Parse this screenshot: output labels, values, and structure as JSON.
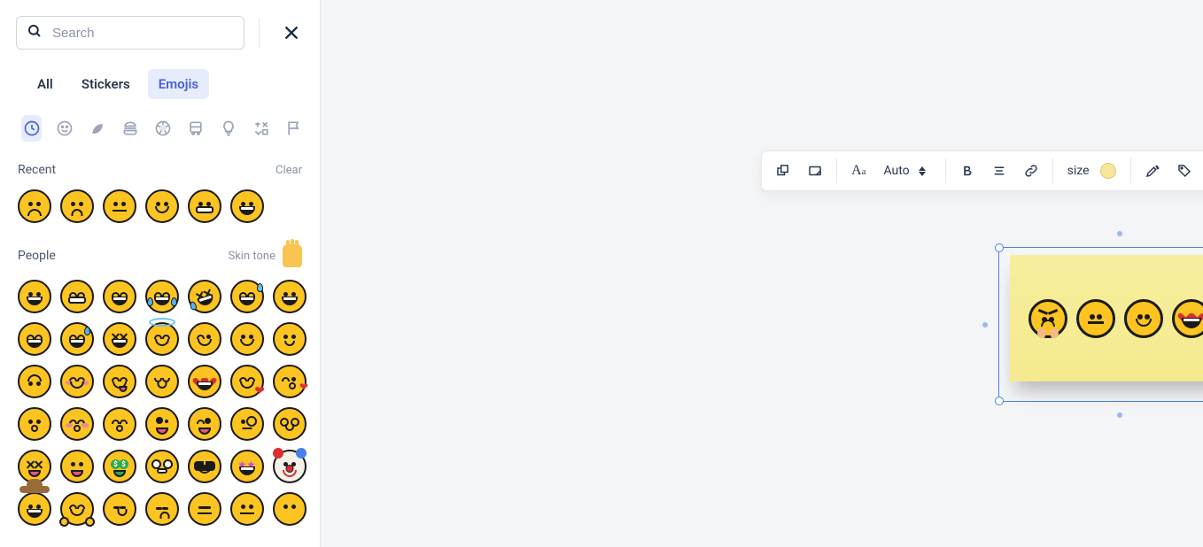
{
  "sidebar": {
    "search_placeholder": "Search",
    "tabs": [
      {
        "id": "all",
        "label": "All",
        "active": false
      },
      {
        "id": "stickers",
        "label": "Stickers",
        "active": false
      },
      {
        "id": "emojis",
        "label": "Emojis",
        "active": true
      }
    ],
    "categories": [
      {
        "id": "recent",
        "name": "clock-icon",
        "active": true
      },
      {
        "id": "people",
        "name": "smiley-icon",
        "active": false
      },
      {
        "id": "nature",
        "name": "leaf-icon",
        "active": false
      },
      {
        "id": "food",
        "name": "burger-icon",
        "active": false
      },
      {
        "id": "activity",
        "name": "soccer-icon",
        "active": false
      },
      {
        "id": "travel",
        "name": "bus-icon",
        "active": false
      },
      {
        "id": "objects",
        "name": "lightbulb-icon",
        "active": false
      },
      {
        "id": "symbols",
        "name": "symbols-icon",
        "active": false
      },
      {
        "id": "flags",
        "name": "flag-icon",
        "active": false
      }
    ],
    "sections": {
      "recent": {
        "title": "Recent",
        "action": "Clear"
      },
      "people": {
        "title": "People",
        "skin_tone_label": "Skin tone"
      }
    },
    "recent_emojis": [
      "frown",
      "frown-worried",
      "neutral",
      "smile",
      "grimace",
      "grin"
    ],
    "people_emojis": [
      [
        "grin",
        "beaming",
        "squint-grin",
        "joy-tears",
        "rofl",
        "sweat-joy",
        "grin-big"
      ],
      [
        "smile-open",
        "sweat-smile",
        "xd-laugh",
        "halo",
        "wink",
        "smile",
        "slight-smile"
      ],
      [
        "upside-down",
        "relaxed",
        "yum",
        "relieved",
        "heart-eyes",
        "smiling-hearts",
        "kiss-heart"
      ],
      [
        "kiss",
        "kiss-blush",
        "kiss-smile",
        "zany",
        "tongue-wink",
        "monocle",
        "nerd"
      ],
      [
        "xd-tongue",
        "tongue",
        "money",
        "nerd-glasses",
        "sunglasses",
        "star-struck",
        "clown"
      ],
      [
        "cowboy",
        "hug",
        "smirk",
        "unamused",
        "expressionless",
        "neutral",
        "no-mouth"
      ]
    ]
  },
  "toolbar": {
    "font_label": "Auto",
    "size_label": "size",
    "items": [
      "bring-front",
      "card",
      "sep",
      "font-family",
      "font-size-auto",
      "spinner",
      "sep",
      "bold",
      "align",
      "link",
      "sep",
      "size-label",
      "color-swatch",
      "sep",
      "highlight",
      "tag",
      "emoji",
      "sep",
      "crop",
      "comment",
      "sep",
      "lock",
      "sep",
      "more"
    ]
  },
  "sticky": {
    "emojis": [
      "angry-steam",
      "neutral",
      "smile",
      "heart-eyes-grin"
    ]
  },
  "annotation": {
    "type": "arrow",
    "color": "#d92c2c"
  }
}
